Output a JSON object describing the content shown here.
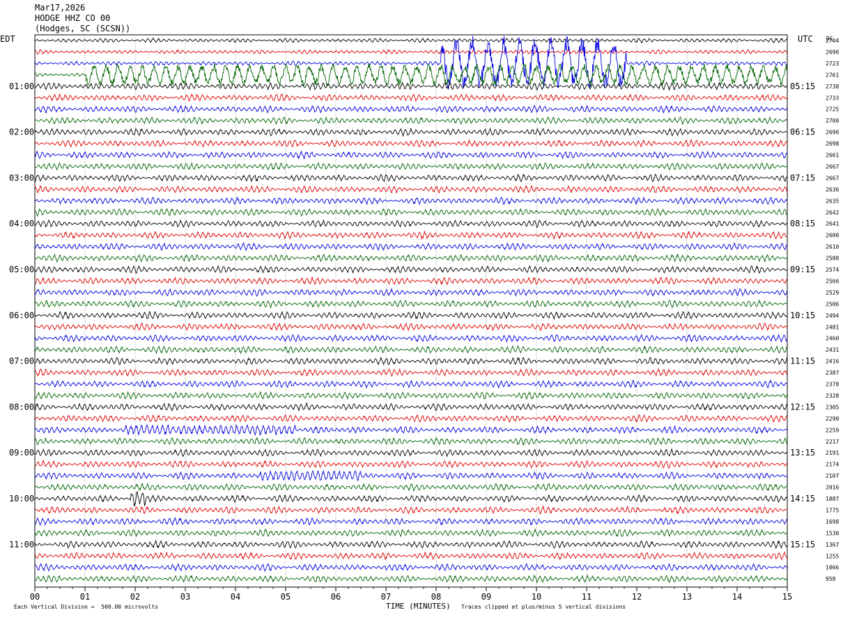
{
  "header": {
    "date": "Mar17,2026",
    "station": "HODGE HHZ CO 00",
    "location": "(Hodges, SC (SCSN))"
  },
  "footer": {
    "scale_note": "Each Vertical Division =  500.00 microvolts",
    "clip_note": "Traces clipped at plus/minus 5 vertical divisions"
  },
  "chart_data": {
    "type": "line",
    "title": "",
    "xlabel": "TIME (MINUTES)",
    "left_axis_label": "EDT",
    "right_axis_label": "UTC",
    "dc_label": "DC",
    "x_ticks": [
      "00",
      "01",
      "02",
      "03",
      "04",
      "05",
      "06",
      "07",
      "08",
      "09",
      "10",
      "11",
      "12",
      "13",
      "14",
      "15"
    ],
    "xlim": [
      0,
      15
    ],
    "trace_minutes": 15,
    "trace_colors": [
      "#000000",
      "#dd0000",
      "#0000dd",
      "#006400"
    ],
    "left_hour_labels": [
      "01:00",
      "02:00",
      "03:00",
      "04:00",
      "05:00",
      "06:00",
      "07:00",
      "08:00",
      "09:00",
      "10:00",
      "11:00"
    ],
    "right_hour_labels": [
      "05:15",
      "06:15",
      "07:15",
      "08:15",
      "09:15",
      "10:15",
      "11:15",
      "12:15",
      "13:15",
      "14:15",
      "15:15"
    ],
    "dc_offsets": [
      "2704",
      "2696",
      "2723",
      "2761",
      "2738",
      "2733",
      "2725",
      "2700",
      "2696",
      "2698",
      "2661",
      "2667",
      "2667",
      "2636",
      "2635",
      "2642",
      "2641",
      "2600",
      "2610",
      "2588",
      "2574",
      "2566",
      "2529",
      "2506",
      "2494",
      "2481",
      "2460",
      "2431",
      "2416",
      "2387",
      "2378",
      "2328",
      "2305",
      "2290",
      "2259",
      "2217",
      "2191",
      "2174",
      "2107",
      "2016",
      "1887",
      "1775",
      "1698",
      "1530",
      "1367",
      "1255",
      "1066",
      "958"
    ],
    "events": [
      {
        "trace": 2,
        "start_min": 8.1,
        "end_min": 11.8,
        "note": "clipped high amplitude"
      },
      {
        "trace": 3,
        "start_min": 1.0,
        "end_min": 15.0,
        "note": "large oscillation"
      },
      {
        "trace": 34,
        "start_min": 1.8,
        "end_min": 5.2,
        "note": "burst"
      },
      {
        "trace": 38,
        "start_min": 4.5,
        "end_min": 6.5,
        "note": "burst"
      },
      {
        "trace": 40,
        "start_min": 1.9,
        "end_min": 2.2,
        "note": "spike"
      }
    ]
  }
}
